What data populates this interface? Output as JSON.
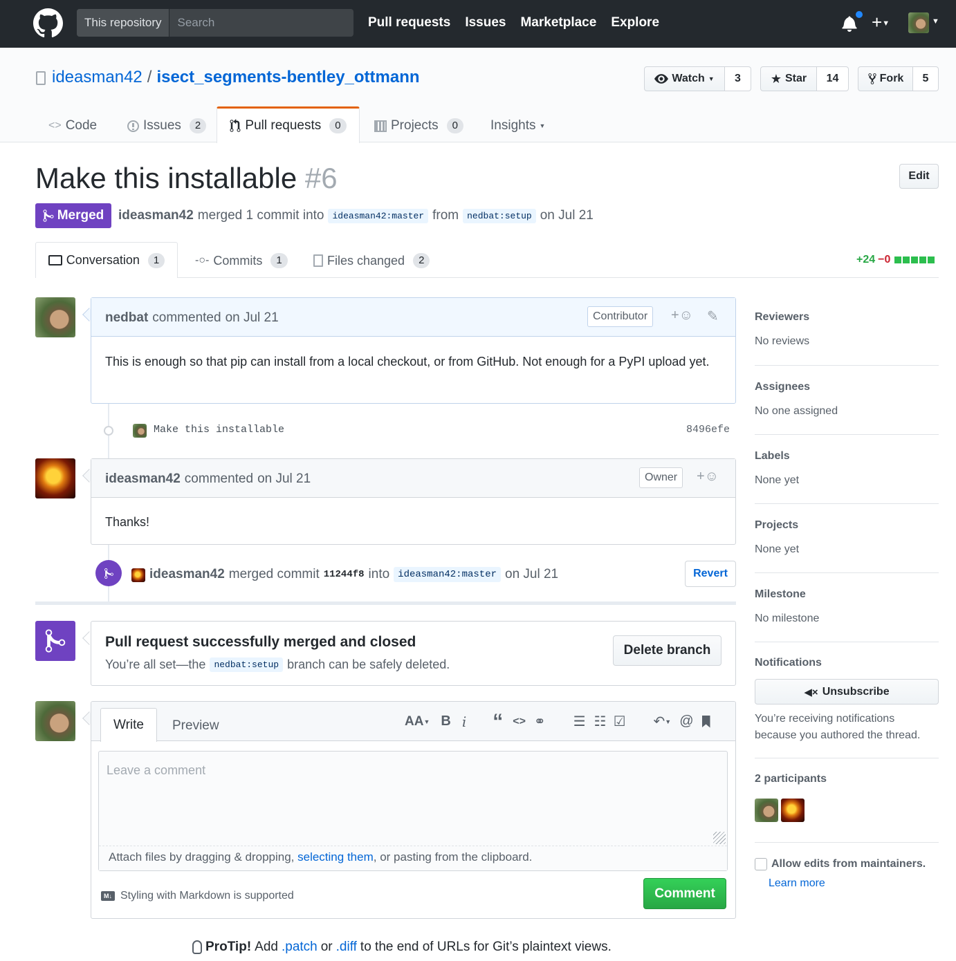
{
  "header": {
    "scope_label": "This repository",
    "search_placeholder": "Search",
    "nav": [
      "Pull requests",
      "Issues",
      "Marketplace",
      "Explore"
    ]
  },
  "repo": {
    "owner": "ideasman42",
    "separator": "/",
    "name": "isect_segments-bentley_ottmann",
    "watch_label": "Watch",
    "watch_count": "3",
    "star_label": "Star",
    "star_count": "14",
    "fork_label": "Fork",
    "fork_count": "5"
  },
  "repo_tabs": [
    {
      "label": "Code",
      "count": ""
    },
    {
      "label": "Issues",
      "count": "2"
    },
    {
      "label": "Pull requests",
      "count": "0"
    },
    {
      "label": "Projects",
      "count": "0"
    },
    {
      "label": "Insights",
      "count": ""
    }
  ],
  "pr": {
    "title": "Make this installable",
    "number": "#6",
    "edit_label": "Edit",
    "state": "Merged",
    "merger": "ideasman42",
    "merged_text": "merged 1 commit into",
    "base_branch": "ideasman42:master",
    "from_text": "from",
    "head_branch": "nedbat:setup",
    "date_text": "on Jul 21"
  },
  "pr_tabs": [
    {
      "label": "Conversation",
      "count": "1"
    },
    {
      "label": "Commits",
      "count": "1"
    },
    {
      "label": "Files changed",
      "count": "2"
    }
  ],
  "diffstat": {
    "additions": "+24",
    "deletions": "−0"
  },
  "timeline": {
    "comment1": {
      "author": "nedbat",
      "action": "commented",
      "date": "on Jul 21",
      "badge": "Contributor",
      "body": "This is enough so that pip can install from a local checkout, or from GitHub. Not enough for a PyPI upload yet."
    },
    "commit": {
      "message": "Make this installable",
      "sha": "8496efe"
    },
    "comment2": {
      "author": "ideasman42",
      "action": "commented",
      "date": "on Jul 21",
      "badge": "Owner",
      "body": "Thanks!"
    },
    "merge_event": {
      "author": "ideasman42",
      "text1": "merged commit",
      "sha": "11244f8",
      "text2": "into",
      "branch": "ideasman42:master",
      "date": "on Jul 21",
      "revert_label": "Revert"
    },
    "merged_box": {
      "title": "Pull request successfully merged and closed",
      "text1": "You’re all set—the",
      "branch": "nedbat:setup",
      "text2": "branch can be safely deleted.",
      "delete_label": "Delete branch"
    }
  },
  "editor": {
    "write_tab": "Write",
    "preview_tab": "Preview",
    "placeholder": "Leave a comment",
    "attach_text1": "Attach files by dragging & dropping,",
    "attach_link": "selecting them",
    "attach_text2": ", or pasting from the clipboard.",
    "markdown_note": "Styling with Markdown is supported",
    "comment_label": "Comment",
    "toolbar": {
      "heading": "AA",
      "bold": "B",
      "italic": "i",
      "quote": "“",
      "code": "<>",
      "mention": "@"
    }
  },
  "sidebar": {
    "reviewers": {
      "title": "Reviewers",
      "value": "No reviews"
    },
    "assignees": {
      "title": "Assignees",
      "value": "No one assigned"
    },
    "labels": {
      "title": "Labels",
      "value": "None yet"
    },
    "projects": {
      "title": "Projects",
      "value": "None yet"
    },
    "milestone": {
      "title": "Milestone",
      "value": "No milestone"
    },
    "notifications": {
      "title": "Notifications",
      "button": "Unsubscribe",
      "reason": "You’re receiving notifications because you authored the thread."
    },
    "participants": {
      "title": "2 participants"
    },
    "allow_edits": "Allow edits from maintainers.",
    "learn_more": "Learn more"
  },
  "protip": {
    "label": "ProTip!",
    "text1": "Add",
    "link1": ".patch",
    "text2": "or",
    "link2": ".diff",
    "text3": "to the end of URLs for Git’s plaintext views."
  },
  "colors": {
    "header_bg": "#24292e",
    "merged_purple": "#6f42c1",
    "link_blue": "#0366d6",
    "green": "#28a745",
    "red": "#cb2431",
    "tab_accent": "#e36209"
  }
}
